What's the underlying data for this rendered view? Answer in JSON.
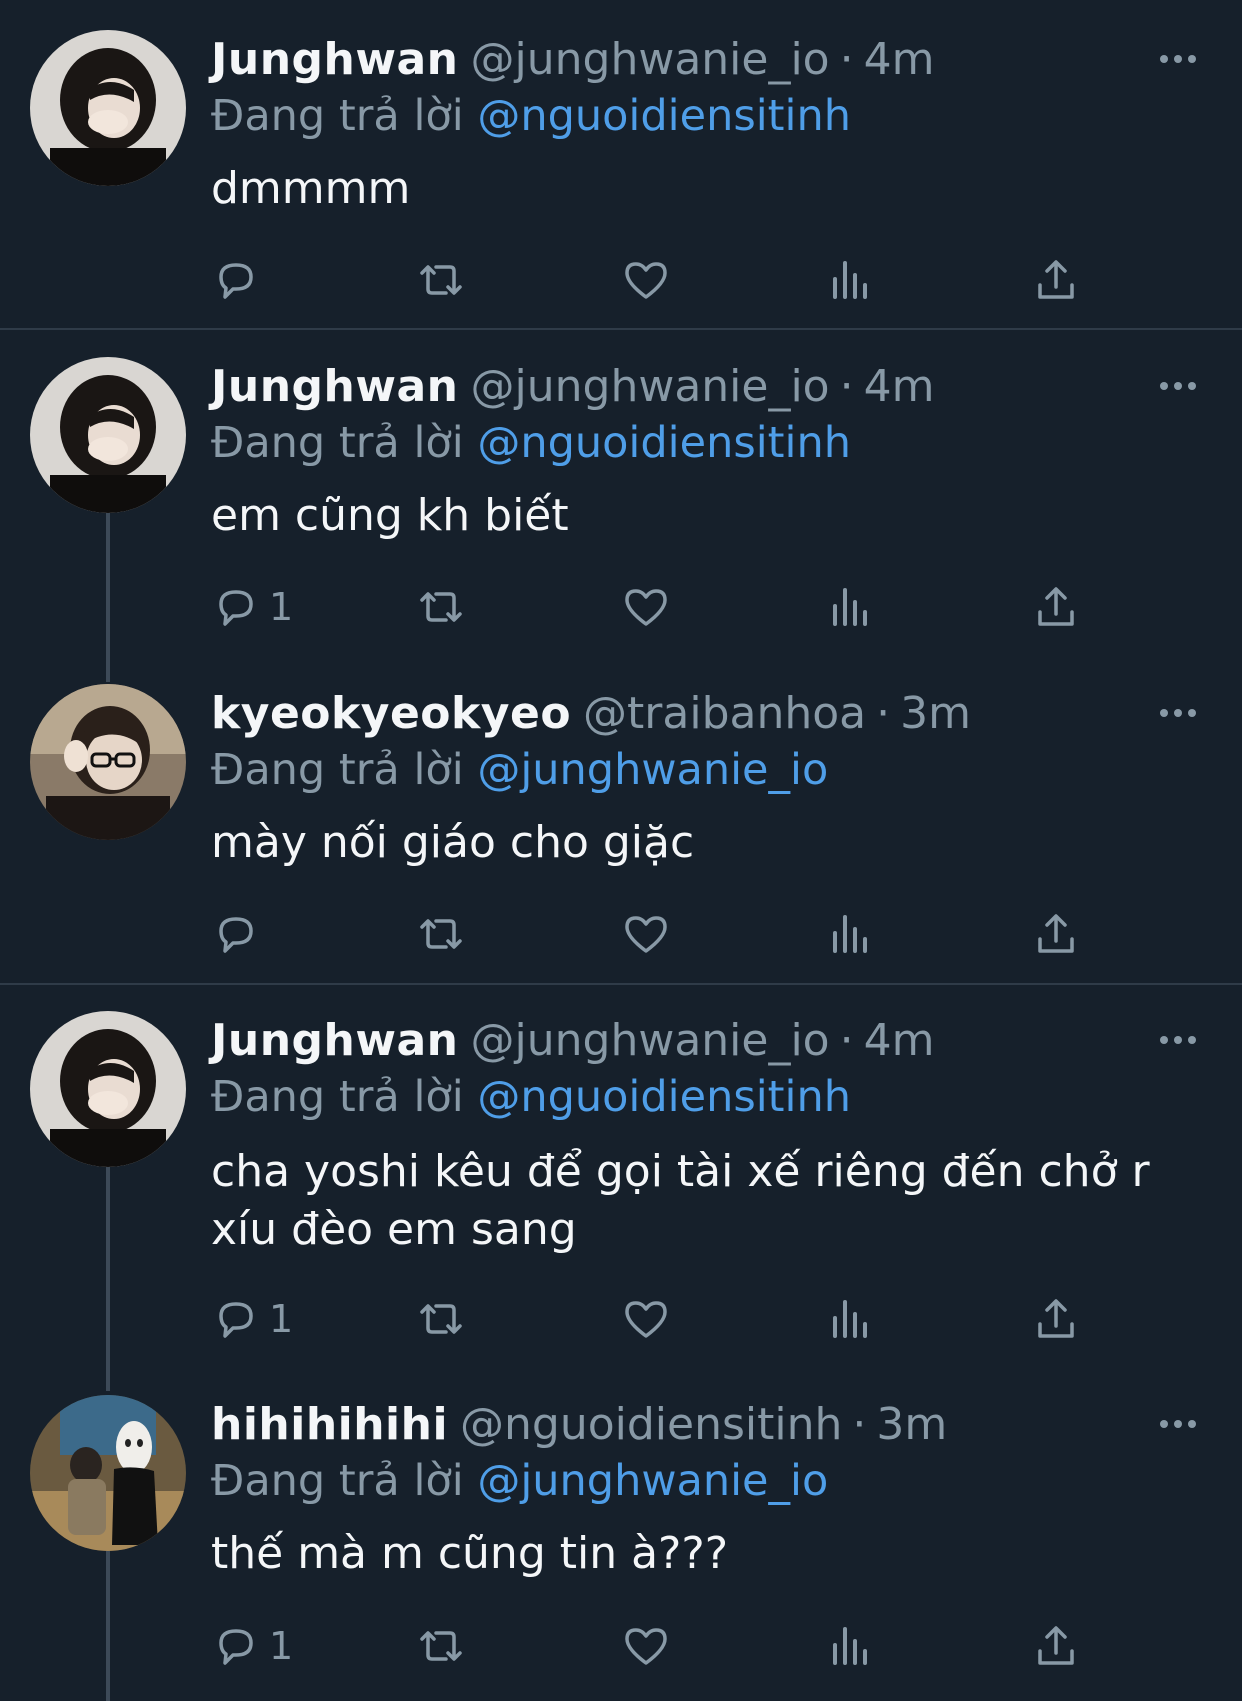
{
  "tweets": [
    {
      "name": "Junghwan",
      "handle": "@junghwanie_io",
      "separator": "·",
      "time": "4m",
      "replying_label": "Đang trả lời",
      "replying_to": "@nguoidiensitinh",
      "text_lines": [
        "dmmmm"
      ],
      "reply_count": "",
      "avatar": "dark-hair-hand-on-face"
    },
    {
      "name": "Junghwan",
      "handle": "@junghwanie_io",
      "separator": "·",
      "time": "4m",
      "replying_label": "Đang trả lời",
      "replying_to": "@nguoidiensitinh",
      "text_lines": [
        "em cũng kh biết"
      ],
      "reply_count": "1",
      "avatar": "dark-hair-hand-on-face"
    },
    {
      "name": "kyeokyeokyeo",
      "handle": "@traibanhoa",
      "separator": "·",
      "time": "3m",
      "replying_label": "Đang trả lời",
      "replying_to": "@junghwanie_io",
      "text_lines": [
        "mày nối giáo cho giặc"
      ],
      "reply_count": "",
      "avatar": "glasses-person"
    },
    {
      "name": "Junghwan",
      "handle": "@junghwanie_io",
      "separator": "·",
      "time": "4m",
      "replying_label": "Đang trả lời",
      "replying_to": "@nguoidiensitinh",
      "text_lines": [
        "cha yoshi kêu để gọi tài xế riêng đến chở r",
        "xíu đèo em sang"
      ],
      "reply_count": "1",
      "avatar": "dark-hair-hand-on-face"
    },
    {
      "name": "hihihihihi",
      "handle": "@nguoidiensitinh",
      "separator": "·",
      "time": "3m",
      "replying_label": "Đang trả lời",
      "replying_to": "@junghwanie_io",
      "text_lines": [
        "thế mà m cũng tin à???"
      ],
      "reply_count": "1",
      "avatar": "no-face-spirit-photo"
    }
  ],
  "icons": {
    "reply": "reply-icon",
    "retweet": "retweet-icon",
    "like": "heart-icon",
    "views": "views-icon",
    "share": "share-icon",
    "more": "more-icon"
  },
  "colors": {
    "background": "#16202b",
    "text": "#f4f6f8",
    "muted": "#8899a6",
    "mention": "#4f9ee8",
    "divider": "#2f3b48"
  }
}
